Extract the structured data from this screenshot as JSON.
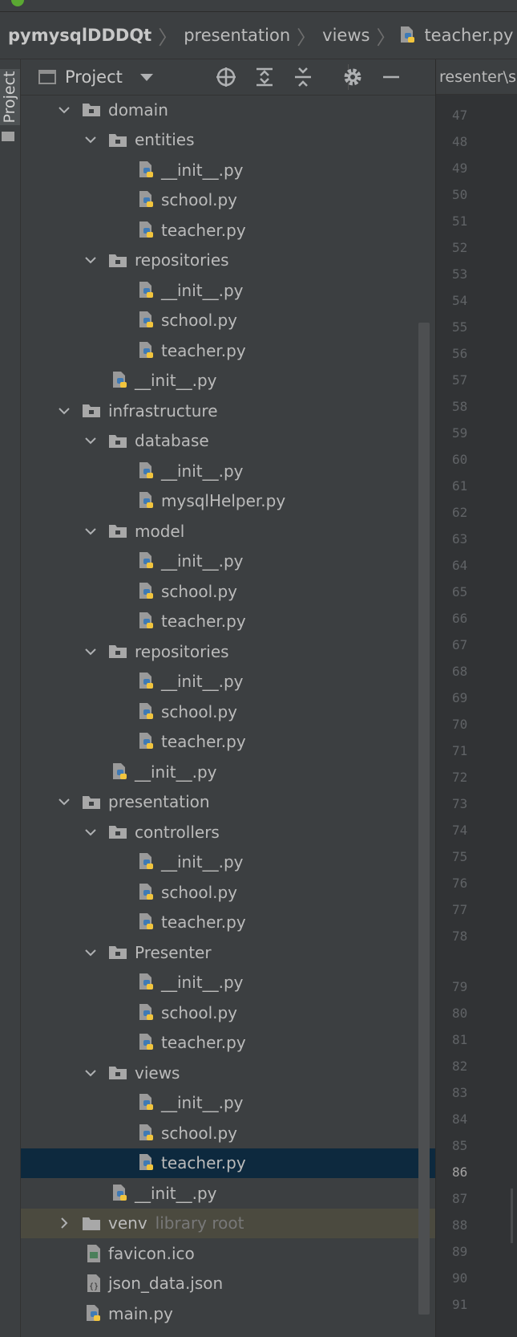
{
  "breadcrumb": {
    "items": [
      "pymysqlDDDQt",
      "presentation",
      "views",
      "teacher.py"
    ]
  },
  "sidebar": {
    "tab_label": "Project"
  },
  "toolbar": {
    "title": "Project",
    "buttons": [
      "locate-icon",
      "expand-all-icon",
      "collapse-all-icon",
      "gear-icon",
      "minimize-icon"
    ]
  },
  "tree": [
    {
      "label": "domain",
      "type": "folder",
      "depth": 0,
      "expanded": true
    },
    {
      "label": "entities",
      "type": "folder",
      "depth": 1,
      "expanded": true
    },
    {
      "label": "__init__.py",
      "type": "py",
      "depth": 2
    },
    {
      "label": "school.py",
      "type": "py",
      "depth": 2
    },
    {
      "label": "teacher.py",
      "type": "py",
      "depth": 2
    },
    {
      "label": "repositories",
      "type": "folder",
      "depth": 1,
      "expanded": true
    },
    {
      "label": "__init__.py",
      "type": "py",
      "depth": 2
    },
    {
      "label": "school.py",
      "type": "py",
      "depth": 2
    },
    {
      "label": "teacher.py",
      "type": "py",
      "depth": 2
    },
    {
      "label": "__init__.py",
      "type": "py",
      "depth": 1
    },
    {
      "label": "infrastructure",
      "type": "folder",
      "depth": 0,
      "expanded": true
    },
    {
      "label": "database",
      "type": "folder",
      "depth": 1,
      "expanded": true
    },
    {
      "label": "__init__.py",
      "type": "py",
      "depth": 2
    },
    {
      "label": "mysqlHelper.py",
      "type": "py",
      "depth": 2
    },
    {
      "label": "model",
      "type": "folder",
      "depth": 1,
      "expanded": true
    },
    {
      "label": "__init__.py",
      "type": "py",
      "depth": 2
    },
    {
      "label": "school.py",
      "type": "py",
      "depth": 2
    },
    {
      "label": "teacher.py",
      "type": "py",
      "depth": 2
    },
    {
      "label": "repositories",
      "type": "folder",
      "depth": 1,
      "expanded": true
    },
    {
      "label": "__init__.py",
      "type": "py",
      "depth": 2
    },
    {
      "label": "school.py",
      "type": "py",
      "depth": 2
    },
    {
      "label": "teacher.py",
      "type": "py",
      "depth": 2
    },
    {
      "label": "__init__.py",
      "type": "py",
      "depth": 1
    },
    {
      "label": "presentation",
      "type": "folder",
      "depth": 0,
      "expanded": true
    },
    {
      "label": "controllers",
      "type": "folder",
      "depth": 1,
      "expanded": true
    },
    {
      "label": "__init__.py",
      "type": "py",
      "depth": 2
    },
    {
      "label": "school.py",
      "type": "py",
      "depth": 2
    },
    {
      "label": "teacher.py",
      "type": "py",
      "depth": 2
    },
    {
      "label": "Presenter",
      "type": "folder",
      "depth": 1,
      "expanded": true
    },
    {
      "label": "__init__.py",
      "type": "py",
      "depth": 2
    },
    {
      "label": "school.py",
      "type": "py",
      "depth": 2
    },
    {
      "label": "teacher.py",
      "type": "py",
      "depth": 2
    },
    {
      "label": "views",
      "type": "folder",
      "depth": 1,
      "expanded": true
    },
    {
      "label": "__init__.py",
      "type": "py",
      "depth": 2
    },
    {
      "label": "school.py",
      "type": "py",
      "depth": 2
    },
    {
      "label": "teacher.py",
      "type": "py",
      "depth": 2,
      "selected": true
    },
    {
      "label": "__init__.py",
      "type": "py",
      "depth": 1
    },
    {
      "label": "venv",
      "type": "folder",
      "depth": 0,
      "expanded": false,
      "hint": "library root",
      "highlight": true
    },
    {
      "label": "favicon.ico",
      "type": "image",
      "depth": 0
    },
    {
      "label": "json_data.json",
      "type": "json",
      "depth": 0
    },
    {
      "label": "main.py",
      "type": "py",
      "depth": 0
    }
  ],
  "editor": {
    "tab_label": "resenter\\s",
    "line_numbers": [
      "47",
      "48",
      "49",
      "50",
      "51",
      "52",
      "53",
      "54",
      "55",
      "56",
      "57",
      "58",
      "59",
      "60",
      "61",
      "62",
      "63",
      "64",
      "65",
      "66",
      "67",
      "68",
      "69",
      "70",
      "71",
      "72",
      "73",
      "74",
      "75",
      "76",
      "77",
      "78",
      "79",
      "80",
      "81",
      "82",
      "83",
      "84",
      "85",
      "86",
      "87",
      "88",
      "89",
      "90",
      "91"
    ],
    "current_line": "86"
  },
  "colors": {
    "panel_bg": "#3c3f41",
    "selection_bg": "#0d293e",
    "venv_bg": "#4b4a3f",
    "folder_icon": "#a8a8a8",
    "python_blue": "#3f7ab5",
    "python_yellow": "#f2c53d"
  }
}
